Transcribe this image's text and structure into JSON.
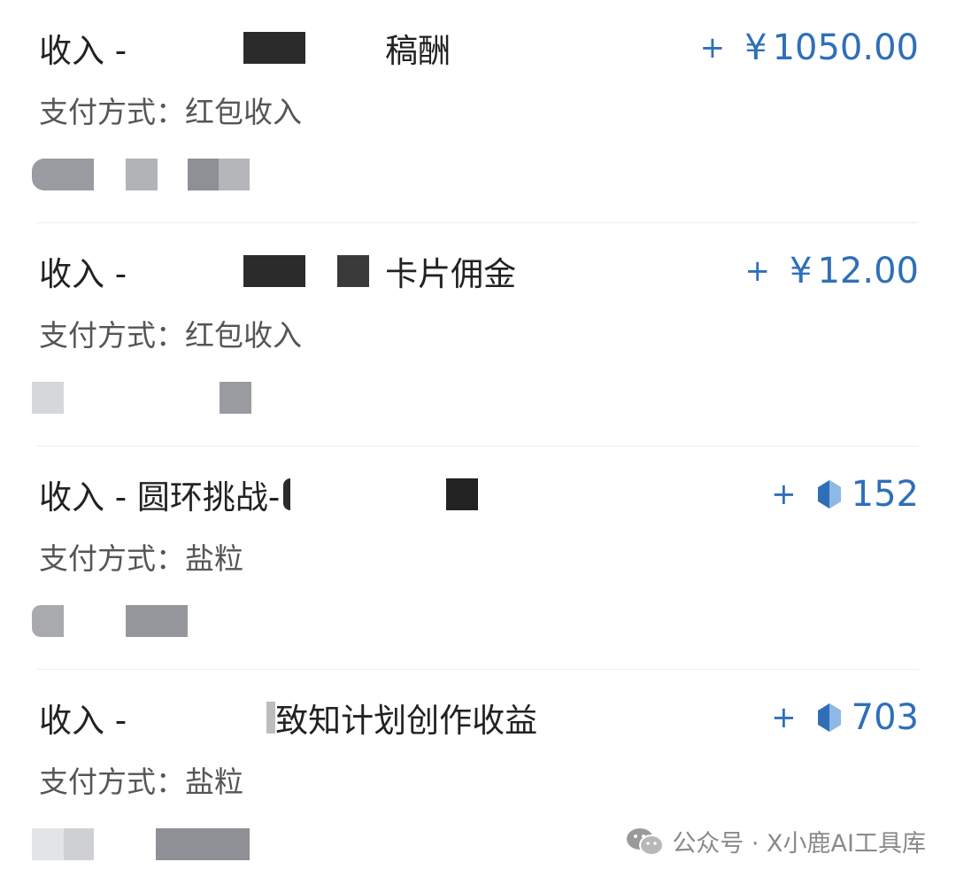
{
  "records": [
    {
      "title_prefix": "收入 -",
      "title_suffix": "稿酬",
      "amount_sign": "+",
      "currency_symbol": "¥",
      "amount": "1050.00",
      "currency_type": "rmb",
      "payment": "支付方式：红包收入"
    },
    {
      "title_prefix": "收入 -",
      "title_suffix": "卡片佣金",
      "amount_sign": "+",
      "currency_symbol": "¥",
      "amount": "12.00",
      "currency_type": "rmb",
      "payment": "支付方式：红包收入"
    },
    {
      "title_prefix": "收入 - 圆环挑战-",
      "title_suffix": "",
      "amount_sign": "+",
      "currency_symbol": "",
      "amount": "152",
      "currency_type": "salt-grain-gem-icon",
      "payment": "支付方式：盐粒"
    },
    {
      "title_prefix": "收入 -",
      "title_suffix": "致知计划创作收益",
      "amount_sign": "+",
      "currency_symbol": "",
      "amount": "703",
      "currency_type": "salt-grain-gem-icon",
      "payment": "支付方式：盐粒"
    }
  ],
  "watermark": {
    "icon": "wechat-icon",
    "text": "公众号 · X小鹿AI工具库"
  },
  "colors": {
    "amount": "#2f6fb8",
    "title": "#222222",
    "payment": "#555555",
    "divider": "#ececec",
    "redaction_dark": "#2b2b2b",
    "redaction_gray": "#9a9ba0",
    "redaction_light": "#d6d7da"
  }
}
